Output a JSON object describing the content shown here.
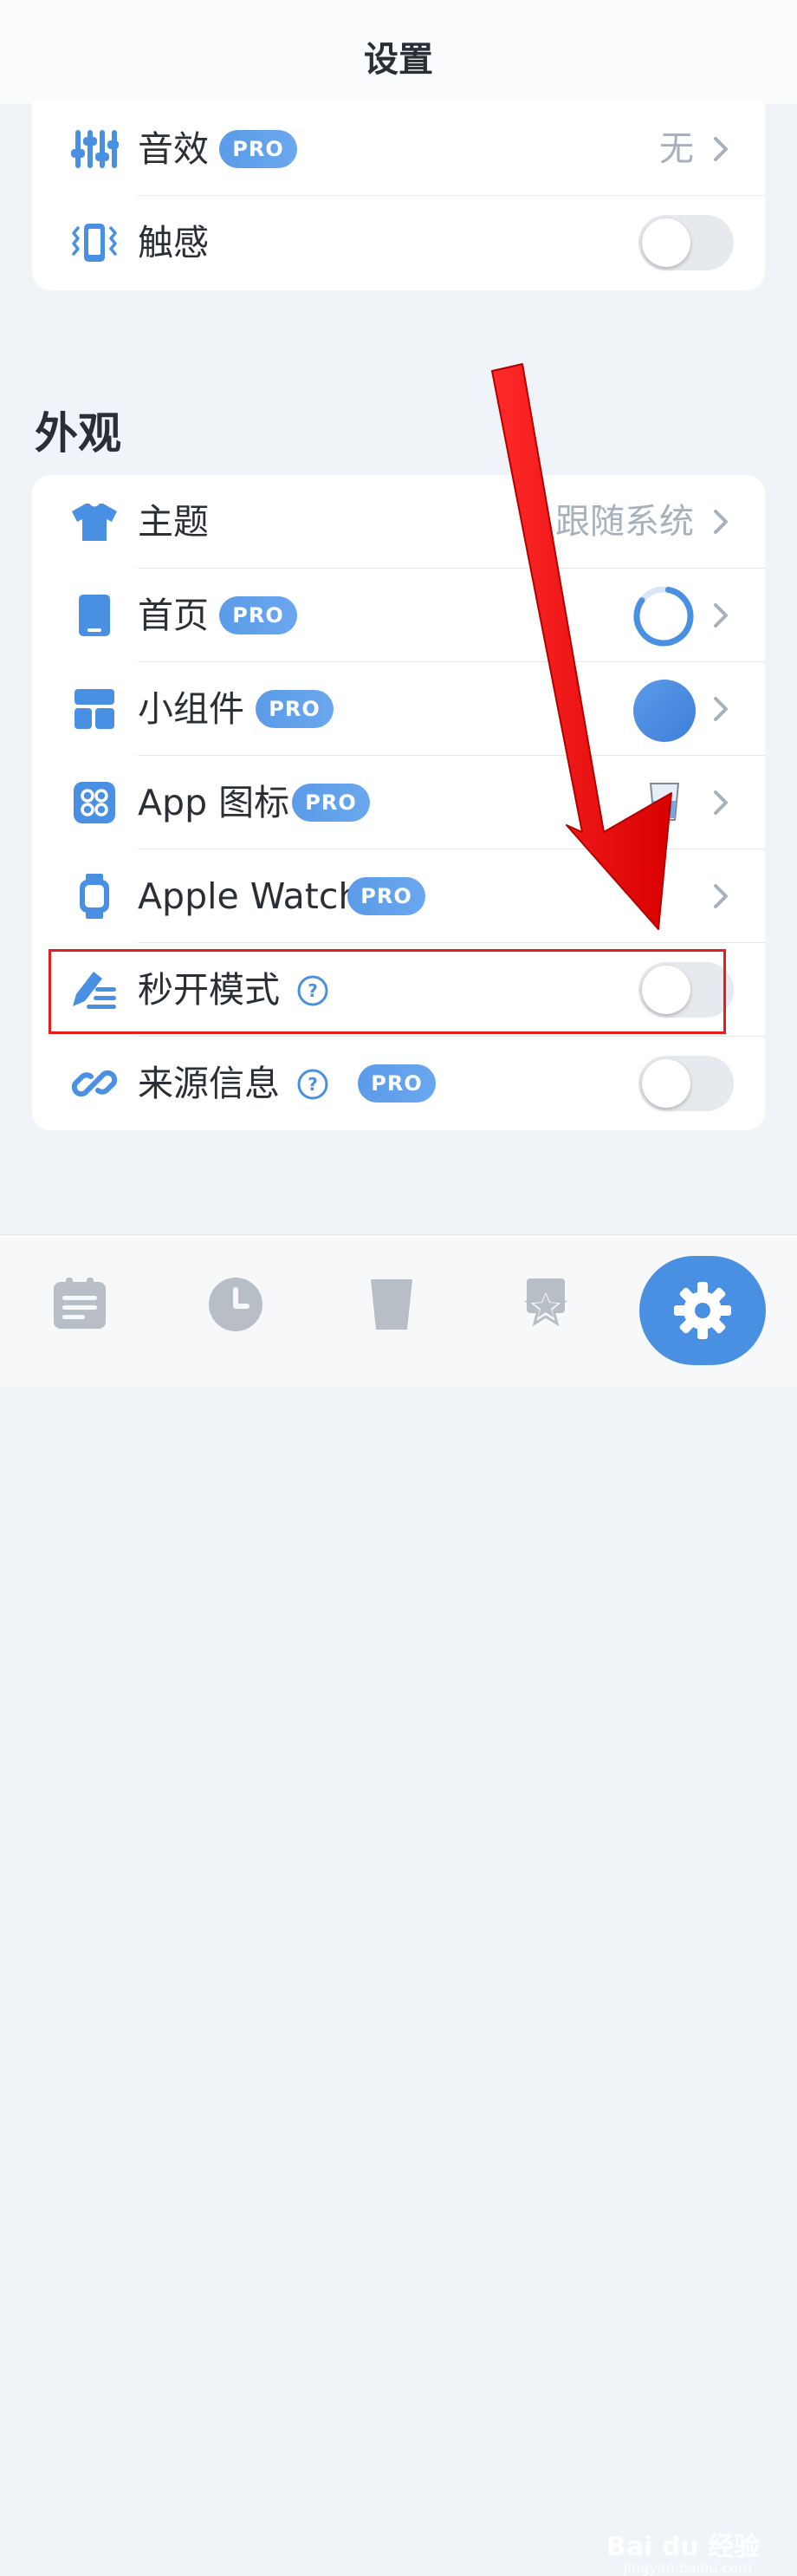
{
  "header": {
    "title": "设置"
  },
  "sound_card": {
    "rows": [
      {
        "label": "音效",
        "pro": "PRO",
        "value": "无"
      },
      {
        "label": "触感",
        "toggle_on": false
      }
    ]
  },
  "appearance": {
    "section_title": "外观",
    "rows": [
      {
        "label": "主题",
        "value": "跟随系统"
      },
      {
        "label": "首页",
        "pro": "PRO"
      },
      {
        "label": "小组件",
        "pro": "PRO"
      },
      {
        "label": "App 图标",
        "pro": "PRO"
      },
      {
        "label": "Apple Watch",
        "pro": "PRO"
      },
      {
        "label": "秒开模式",
        "toggle_on": false
      },
      {
        "label": "来源信息",
        "pro": "PRO",
        "toggle_on": false
      }
    ]
  },
  "colors": {
    "accent": "#4a90e2",
    "highlight": "#e81c1c",
    "pro_badge": "#5b9be8"
  },
  "tabbar": {
    "tabs": [
      "list-icon",
      "clock-icon",
      "cup-icon",
      "star-icon",
      "gear-icon"
    ],
    "active": "gear-icon"
  },
  "watermark": {
    "text": "Bai du 经验",
    "sub": "jingyan.baidu.com"
  }
}
